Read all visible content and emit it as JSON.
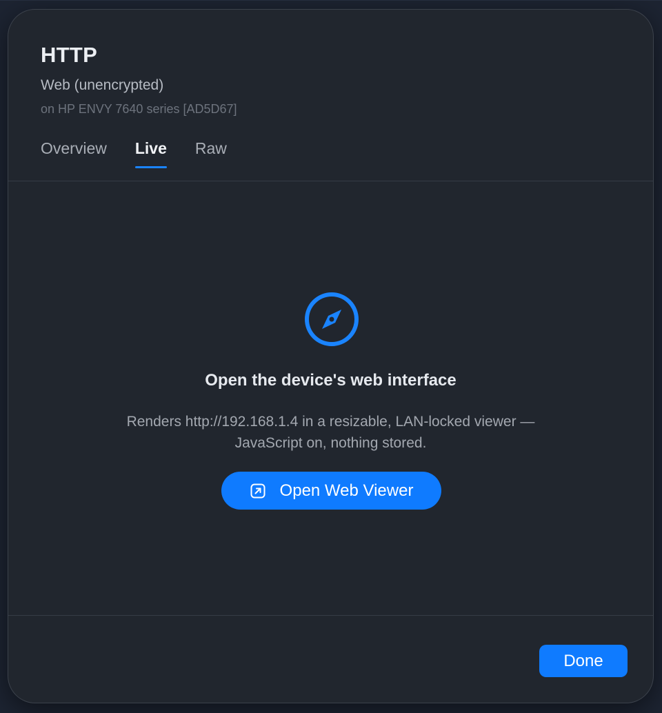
{
  "sheet": {
    "title": "HTTP",
    "subtitle": "Web (unencrypted)",
    "device_line": "on HP ENVY 7640 series [AD5D67]",
    "tabs": [
      {
        "label": "Overview",
        "active": false
      },
      {
        "label": "Live",
        "active": true
      },
      {
        "label": "Raw",
        "active": false
      }
    ]
  },
  "live": {
    "icon": "compass-icon",
    "headline": "Open the device's web interface",
    "description_line1": "Renders http://192.168.1.4 in a resizable, LAN-locked viewer —",
    "description_line2": "JavaScript on, nothing stored.",
    "open_button_icon": "open-external-icon",
    "open_button_label": "Open Web Viewer"
  },
  "footer": {
    "done_label": "Done"
  },
  "colors": {
    "accent": "#0f7bff",
    "sheet_bg": "#21262e"
  }
}
